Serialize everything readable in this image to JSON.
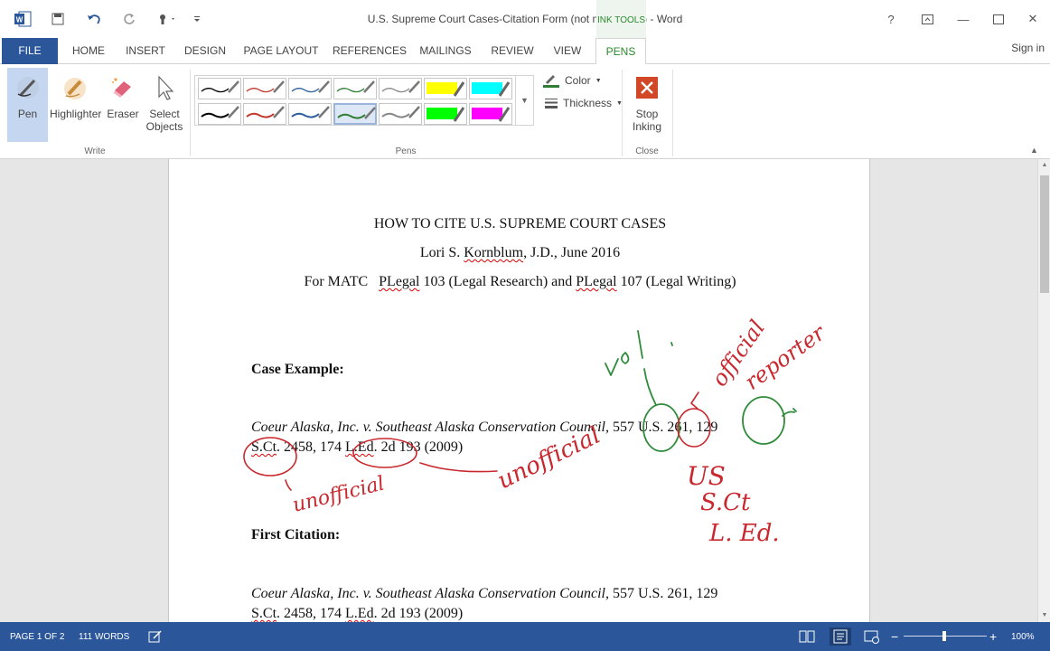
{
  "window": {
    "title": "U.S. Supreme Court Cases-Citation Form (not marked up) - Word",
    "contextual_tab_group": "INK TOOLS",
    "help": "?",
    "minimize": "—",
    "close": "✕"
  },
  "tabs": [
    "FILE",
    "HOME",
    "INSERT",
    "DESIGN",
    "PAGE LAYOUT",
    "REFERENCES",
    "MAILINGS",
    "REVIEW",
    "VIEW",
    "PENS"
  ],
  "signin": "Sign in",
  "ribbon": {
    "write": {
      "label": "Write",
      "pen": "Pen",
      "highlighter": "Highlighter",
      "eraser": "Eraser",
      "select_line1": "Select",
      "select_line2": "Objects"
    },
    "pens": {
      "label": "Pens",
      "color": "Color",
      "thickness": "Thickness",
      "swatches_row1": [
        "#000000",
        "#c0392b",
        "#2e5e9e",
        "#2e7d32",
        "#888888",
        "#ffff00",
        "#00ffff"
      ],
      "swatches_row2": [
        "#000000",
        "#c0392b",
        "#2e5e9e",
        "#2e7d32",
        "#888888",
        "#00ff00",
        "#ff00ff"
      ]
    },
    "close": {
      "label": "Close",
      "stop_line1": "Stop",
      "stop_line2": "Inking"
    }
  },
  "document": {
    "title": "HOW TO CITE U.S. SUPREME COURT CASES",
    "author_prefix": "Lori S. ",
    "author_name": "Kornblum",
    "author_suffix": ", J.D., June 2016",
    "course_prefix": "For MATC   ",
    "course_pl1": "PLegal",
    "course_mid": " 103 (Legal Research) and ",
    "course_pl2": "PLegal",
    "course_suffix": " 107 (Legal Writing)",
    "case_example_heading": "Case Example:",
    "case_name": "Coeur Alaska, Inc. v. Southeast Alaska Conservation Council,",
    "citation_line1_rest": " 557 U.S. 261, 129",
    "sct": "S.Ct",
    "citation_mid": ". 2458, 174 ",
    "led": "L.Ed",
    "citation_end": ". 2d 193 (2009)",
    "first_citation_heading": "First Citation:"
  },
  "status": {
    "page": "PAGE 1 OF 2",
    "words": "111 WORDS",
    "zoom": "100%",
    "zoom_level_percent": 100
  }
}
